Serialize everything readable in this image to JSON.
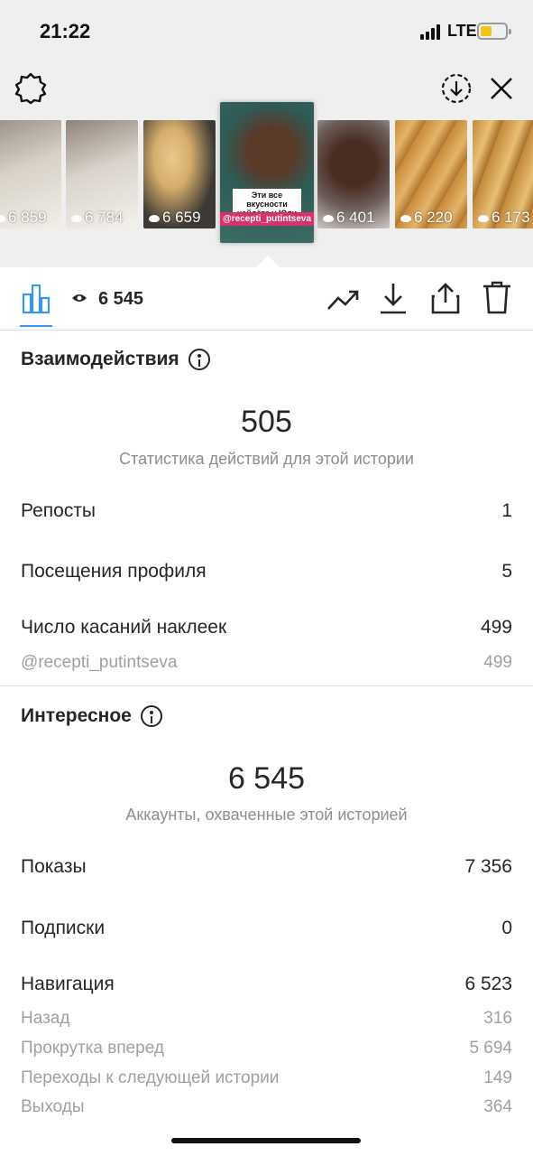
{
  "status_bar": {
    "time": "21:22",
    "network": "LTE"
  },
  "thumbnails": [
    {
      "views": "6 859",
      "colors": [
        "#9a8f84",
        "#f2efe8"
      ]
    },
    {
      "views": "6 784",
      "colors": [
        "#8f8378",
        "#f4f1eb"
      ]
    },
    {
      "views": "6 659",
      "colors": [
        "#3d3a36",
        "#e8c98e"
      ]
    },
    {
      "views": "",
      "colors": [
        "#2f5a55",
        "#5b3a2a"
      ],
      "selected": true,
      "caption": "Эти все вкусности найдёте у Юли",
      "mention": "@recepti_putintseva"
    },
    {
      "views": "6 401",
      "colors": [
        "#6b5e5a",
        "#4a2d22"
      ]
    },
    {
      "views": "6 220",
      "colors": [
        "#c98a3a",
        "#e4b46a"
      ]
    },
    {
      "views": "6 173",
      "colors": [
        "#c2893a",
        "#e8bf75"
      ]
    }
  ],
  "toolbar": {
    "views": "6 545"
  },
  "interactions": {
    "title": "Взаимодействия",
    "total": "505",
    "caption": "Статистика действий для этой истории",
    "reposts_label": "Репосты",
    "reposts_value": "1",
    "profile_visits_label": "Посещения профиля",
    "profile_visits_value": "5",
    "sticker_taps_label": "Число касаний наклеек",
    "sticker_taps_value": "499",
    "sticker_account_label": "@recepti_putintseva",
    "sticker_account_value": "499"
  },
  "discovery": {
    "title": "Интересное",
    "total": "6 545",
    "caption": "Аккаунты, охваченные этой историей",
    "impressions_label": "Показы",
    "impressions_value": "7 356",
    "follows_label": "Подписки",
    "follows_value": "0",
    "navigation_label": "Навигация",
    "navigation_value": "6 523",
    "back_label": "Назад",
    "back_value": "316",
    "forward_label": "Прокрутка вперед",
    "forward_value": "5 694",
    "next_story_label": "Переходы к следующей истории",
    "next_story_value": "149",
    "exits_label": "Выходы",
    "exits_value": "364"
  },
  "accent_color": "#3897f0"
}
